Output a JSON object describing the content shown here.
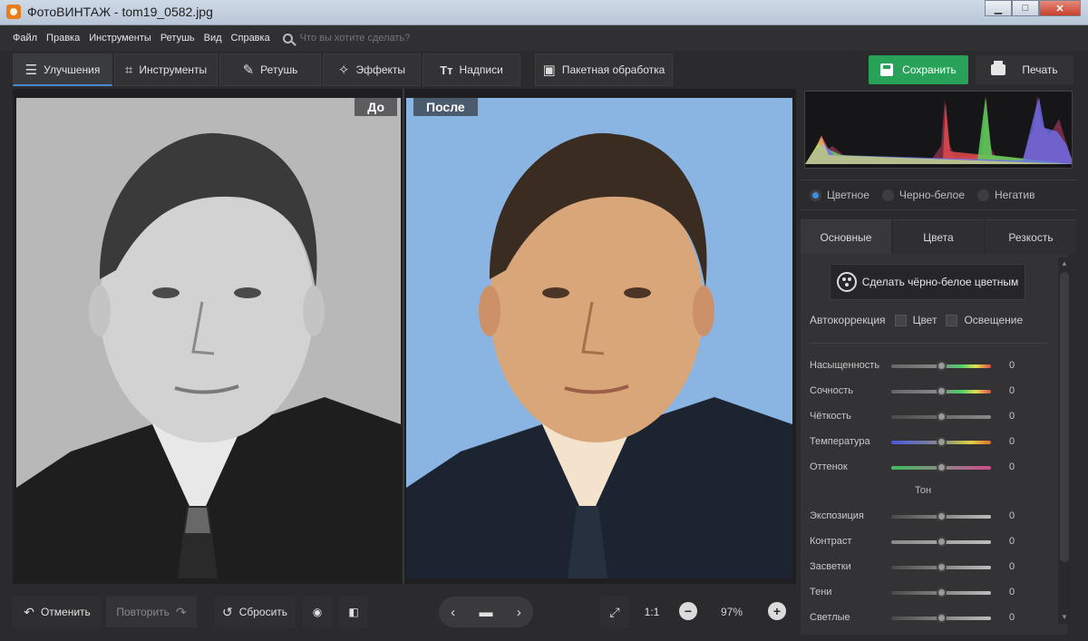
{
  "window": {
    "title": "ФотоВИНТАЖ - tom19_0582.jpg",
    "min_glyph": "▁",
    "max_glyph": "□",
    "close_glyph": "✕"
  },
  "menu": {
    "items": [
      "Файл",
      "Правка",
      "Инструменты",
      "Ретушь",
      "Вид",
      "Справка"
    ],
    "search_placeholder": "Что вы хотите сделать?"
  },
  "toolbar": {
    "tabs": [
      {
        "label": "Улучшения",
        "icon": "sliders-icon",
        "glyph": "☰"
      },
      {
        "label": "Инструменты",
        "icon": "crop-icon",
        "glyph": "⌗"
      },
      {
        "label": "Ретушь",
        "icon": "brush-icon",
        "glyph": "✎"
      },
      {
        "label": "Эффекты",
        "icon": "magic-wand-icon",
        "glyph": "✧"
      },
      {
        "label": "Надписи",
        "icon": "text-icon",
        "glyph": "Tт"
      },
      {
        "label": "Пакетная обработка",
        "icon": "images-icon",
        "glyph": "▣"
      }
    ],
    "save_label": "Сохранить",
    "print_label": "Печать"
  },
  "canvas": {
    "before_label": "До",
    "after_label": "После"
  },
  "bottom": {
    "undo_label": "Отменить",
    "redo_label": "Повторить",
    "reset_label": "Сбросить",
    "undo_glyph": "↶",
    "redo_glyph": "↷",
    "reset_glyph": "↺",
    "eye_glyph": "◉",
    "compare_glyph": "◧",
    "prev_glyph": "‹",
    "folder_glyph": "▬",
    "next_glyph": "›",
    "fit_glyph": "⤢",
    "ratio_label": "1:1",
    "zoom_out_glyph": "−",
    "zoom_value": "97%",
    "zoom_in_glyph": "+"
  },
  "panel": {
    "modes": [
      {
        "label": "Цветное",
        "selected": true
      },
      {
        "label": "Черно-белое",
        "selected": false
      },
      {
        "label": "Негатив",
        "selected": false
      }
    ],
    "tabs": [
      "Основные",
      "Цвета",
      "Резкость"
    ],
    "colorize_label": "Сделать чёрно-белое цветным",
    "autocorrection_label": "Автокоррекция",
    "auto_color_label": "Цвет",
    "auto_light_label": "Освещение",
    "sliders": [
      {
        "label": "Насыщенность",
        "value": "0"
      },
      {
        "label": "Сочность",
        "value": "0"
      },
      {
        "label": "Чёткость",
        "value": "0"
      },
      {
        "label": "Температура",
        "value": "0"
      },
      {
        "label": "Оттенок",
        "value": "0"
      }
    ],
    "tone_title": "Тон",
    "tone_sliders": [
      {
        "label": "Экспозиция",
        "value": "0"
      },
      {
        "label": "Контраст",
        "value": "0"
      },
      {
        "label": "Засветки",
        "value": "0"
      },
      {
        "label": "Тени",
        "value": "0"
      },
      {
        "label": "Светлые",
        "value": "0"
      }
    ]
  }
}
